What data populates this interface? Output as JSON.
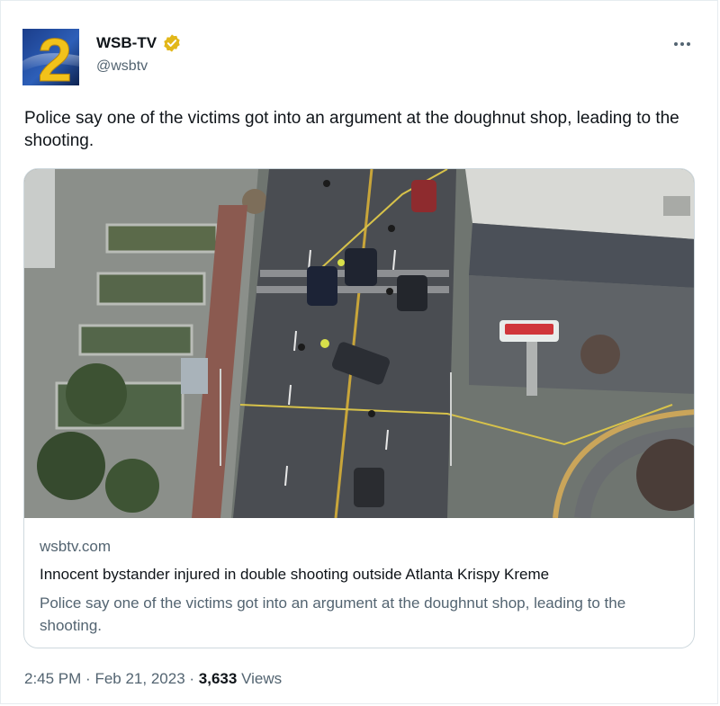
{
  "author": {
    "display_name": "WSB-TV",
    "handle": "@wsbtv",
    "avatar_number": "2",
    "verified_icon": "verified-badge-icon"
  },
  "tweet": {
    "text": "Police say one of the victims got into an argument at the doughnut shop, leading to the shooting."
  },
  "card": {
    "domain": "wsbtv.com",
    "title": "Innocent bystander injured in double shooting outside Atlanta Krispy Kreme",
    "description": "Police say one of the victims got into an argument at the doughnut shop, leading to the shooting."
  },
  "meta": {
    "time": "2:45 PM",
    "separator": "·",
    "date": "Feb 21, 2023",
    "views_count": "3,633",
    "views_label": "Views"
  },
  "colors": {
    "text_primary": "#0f1419",
    "text_secondary": "#536471",
    "border": "#cfd9de",
    "verified_gold": "#e2b719"
  }
}
